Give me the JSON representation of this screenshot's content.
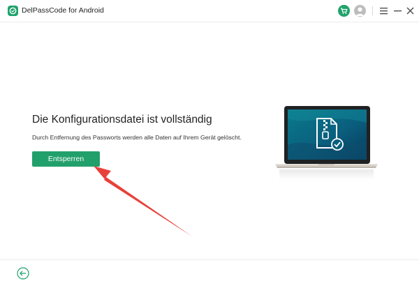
{
  "window": {
    "title": "DelPassCode for Android"
  },
  "main": {
    "headline": "Die Konfigurationsdatei ist vollständig",
    "subtext": "Durch Entfernung des Passworts werden alle Daten auf Ihrem Gerät gelöscht.",
    "unlock_label": "Entsperren"
  },
  "icons": {
    "app_logo": "app-logo-icon",
    "cart": "cart-icon",
    "user": "user-icon",
    "menu": "menu-icon",
    "minimize": "minimize-icon",
    "close": "close-icon",
    "back": "back-arrow-icon",
    "zip_file": "zip-file-check-icon"
  },
  "colors": {
    "accent": "#22a06b",
    "annotation_arrow": "#e8413a",
    "user_avatar": "#bdbdbd"
  }
}
